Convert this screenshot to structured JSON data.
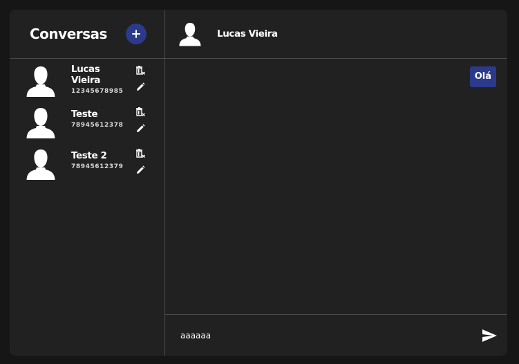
{
  "sidebar": {
    "title": "Conversas",
    "add_icon": "plus-icon",
    "conversations": [
      {
        "name": "Lucas Vieira",
        "phone": "12345678985"
      },
      {
        "name": "Teste",
        "phone": "78945612378"
      },
      {
        "name": "Teste 2",
        "phone": "78945612379"
      }
    ]
  },
  "chat": {
    "contact_name": "Lucas Vieira",
    "messages": [
      {
        "direction": "out",
        "text": "Olá"
      }
    ],
    "input_value": "aaaaaa",
    "send_icon": "send-icon"
  },
  "colors": {
    "background": "#161616",
    "panel": "#212121",
    "divider": "#4a4a4a",
    "accent": "#2b3a8a",
    "text": "#ffffff"
  }
}
